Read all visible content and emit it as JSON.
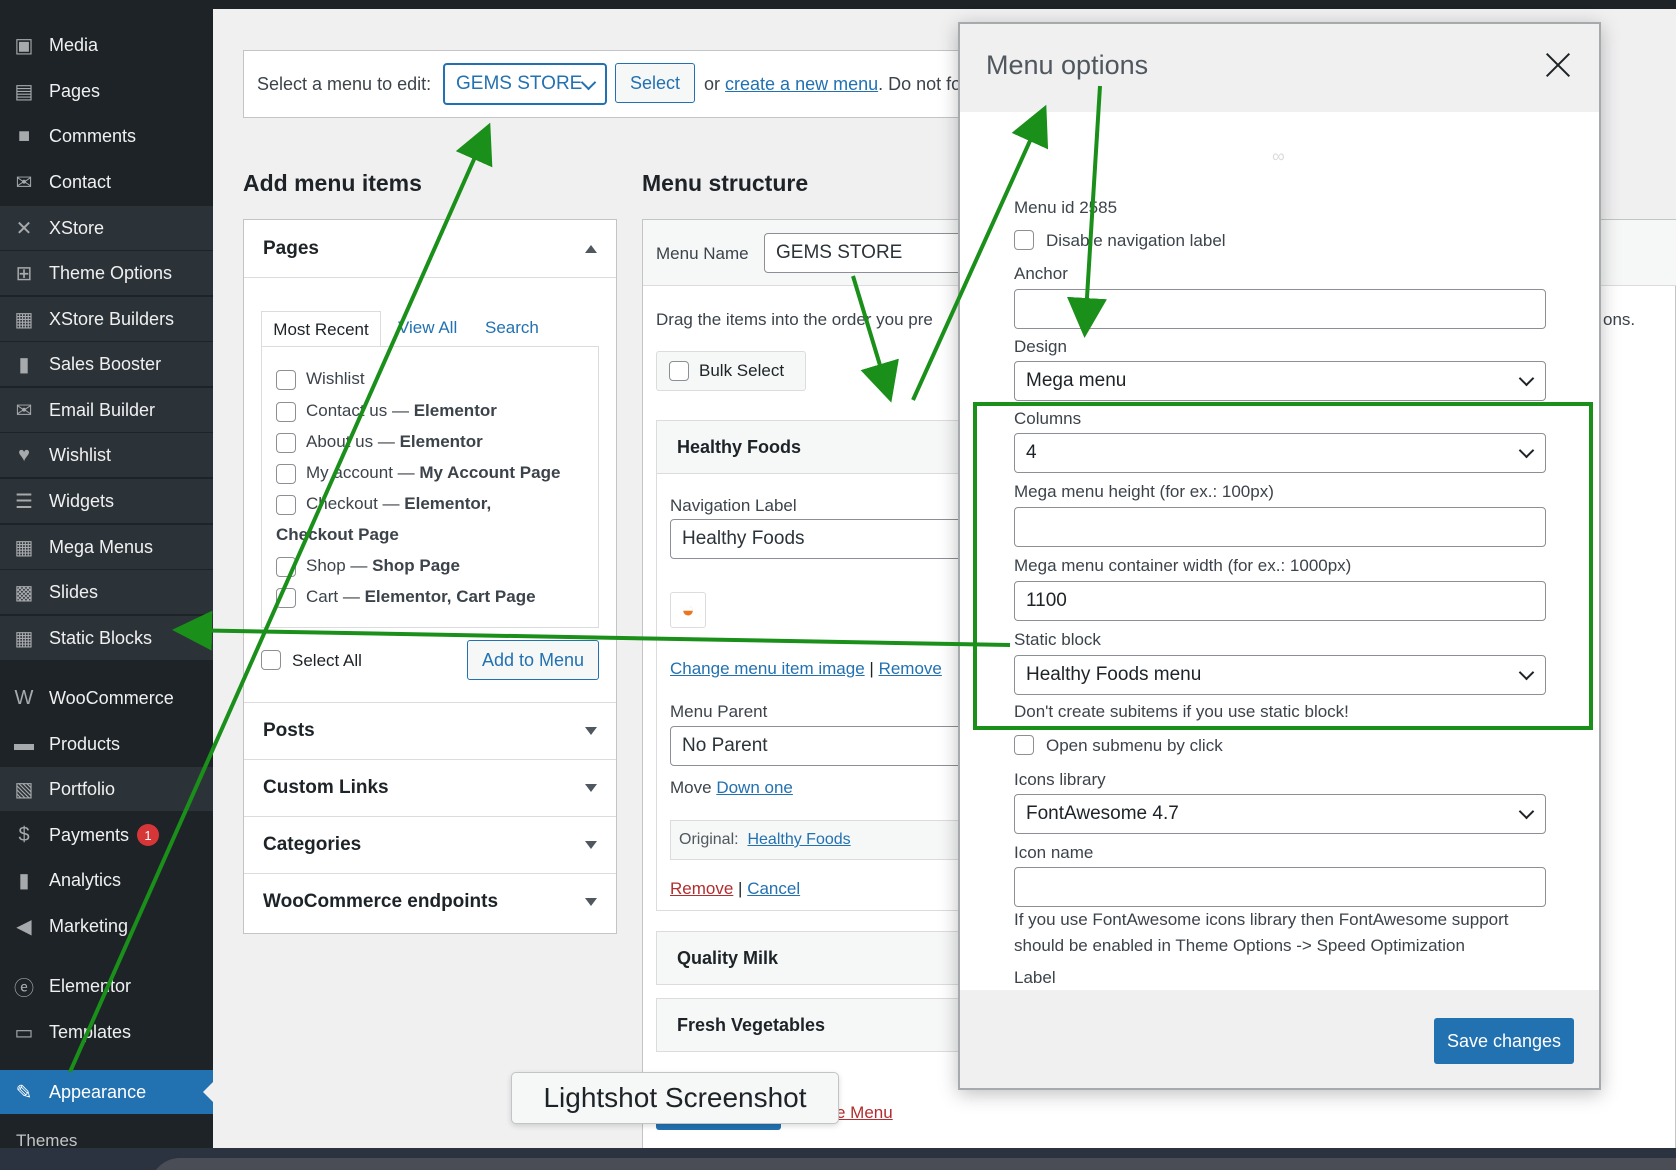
{
  "sidebar": {
    "items": [
      {
        "label": "Media",
        "icon": "media-icon",
        "glyph": "▣"
      },
      {
        "label": "Pages",
        "icon": "pages-icon",
        "glyph": "▤"
      },
      {
        "label": "Comments",
        "icon": "comments-icon",
        "glyph": "■"
      },
      {
        "label": "Contact",
        "icon": "mail-icon",
        "glyph": "✉"
      },
      {
        "label": "XStore",
        "icon": "xstore-icon",
        "glyph": "✕"
      },
      {
        "label": "Theme Options",
        "icon": "theme-options-icon",
        "glyph": "⊞"
      },
      {
        "label": "XStore Builders",
        "icon": "builders-icon",
        "glyph": "▦"
      },
      {
        "label": "Sales Booster",
        "icon": "chart-icon",
        "glyph": "▮"
      },
      {
        "label": "Email Builder",
        "icon": "email-icon",
        "glyph": "✉"
      },
      {
        "label": "Wishlist",
        "icon": "heart-icon",
        "glyph": "♥"
      },
      {
        "label": "Widgets",
        "icon": "widgets-icon",
        "glyph": "☰"
      },
      {
        "label": "Mega Menus",
        "icon": "mega-menus-icon",
        "glyph": "▦"
      },
      {
        "label": "Slides",
        "icon": "slides-icon",
        "glyph": "▩"
      },
      {
        "label": "Static Blocks",
        "icon": "static-blocks-icon",
        "glyph": "▦"
      },
      {
        "label": "WooCommerce",
        "icon": "woocommerce-icon",
        "glyph": "W"
      },
      {
        "label": "Products",
        "icon": "products-icon",
        "glyph": "▬"
      },
      {
        "label": "Portfolio",
        "icon": "portfolio-icon",
        "glyph": "▧"
      },
      {
        "label": "Payments",
        "icon": "payments-icon",
        "glyph": "$"
      },
      {
        "label": "Analytics",
        "icon": "analytics-icon",
        "glyph": "▮"
      },
      {
        "label": "Marketing",
        "icon": "megaphone-icon",
        "glyph": "◀"
      },
      {
        "label": "Elementor",
        "icon": "elementor-icon",
        "glyph": "ⓔ"
      },
      {
        "label": "Templates",
        "icon": "folder-icon",
        "glyph": "▭"
      },
      {
        "label": "Appearance",
        "icon": "paintbrush-icon",
        "glyph": "✎"
      }
    ],
    "payments_badge": "1",
    "submenu_themes": "Themes"
  },
  "select_bar": {
    "label": "Select a menu to edit:",
    "selected_menu": "GEMS STORE",
    "select_button": "Select",
    "or_text": "or",
    "create_link": "create a new menu",
    "rest_text": ". Do not fo"
  },
  "add_items": {
    "title": "Add menu items",
    "pages_title": "Pages",
    "tabs": [
      "Most Recent",
      "View All",
      "Search"
    ],
    "pages": [
      {
        "name": "Wishlist",
        "suffix": ""
      },
      {
        "name": "Contact us — ",
        "suffix": "Elementor"
      },
      {
        "name": "About us — ",
        "suffix": "Elementor"
      },
      {
        "name": "My account — ",
        "suffix": "My Account Page"
      },
      {
        "name": "Checkout — ",
        "suffix": "Elementor,"
      },
      {
        "name": "",
        "suffix": "Checkout Page"
      },
      {
        "name": "Shop — ",
        "suffix": "Shop Page"
      },
      {
        "name": "Cart — ",
        "suffix": "Elementor, Cart Page"
      }
    ],
    "select_all": "Select All",
    "add_to_menu": "Add to Menu",
    "sections": [
      "Posts",
      "Custom Links",
      "Categories",
      "WooCommerce endpoints"
    ]
  },
  "structure": {
    "title": "Menu structure",
    "menu_name_label": "Menu Name",
    "menu_name_value": "GEMS STORE",
    "drag_text": "Drag the items into the order you pre",
    "right_text": "ons.",
    "bulk_select": "Bulk Select",
    "item1_title": "Healthy Foods",
    "nav_label_label": "Navigation Label",
    "nav_label_value": "Healthy Foods",
    "change_image": "Change menu item image",
    "separator": "|",
    "remove_image": "Remove",
    "menu_parent_label": "Menu Parent",
    "menu_parent_value": "No Parent",
    "move_label": "Move",
    "move_link": "Down one",
    "original_label": "Original:",
    "original_link": "Healthy Foods",
    "remove": "Remove",
    "cancel": "Cancel",
    "item2_title": "Quality Milk",
    "item3_title": "Fresh Vegetables",
    "delete_menu_fragment": "e Menu"
  },
  "modal": {
    "title": "Menu options",
    "spinner": "∞",
    "menu_id": "Menu id 2585",
    "disable_nav_label": "Disable navigation label",
    "anchor_label": "Anchor",
    "anchor_value": "",
    "design_label": "Design",
    "design_value": "Mega menu",
    "columns_label": "Columns",
    "columns_value": "4",
    "height_label": "Mega menu height (for ex.: 100px)",
    "height_value": "",
    "width_label": "Mega menu container width (for ex.: 1000px)",
    "width_value": "1100",
    "static_block_label": "Static block",
    "static_block_value": "Healthy Foods menu",
    "static_note": "Don't create subitems if you use static block!",
    "open_submenu": "Open submenu by click",
    "icons_library_label": "Icons library",
    "icons_library_value": "FontAwesome 4.7",
    "icon_name_label": "Icon name",
    "icon_name_value": "",
    "fa_note_1": "If you use FontAwesome icons library then FontAwesome support",
    "fa_note_2": "should be enabled in Theme Options -> Speed Optimization",
    "label_label": "Label",
    "save_button": "Save changes"
  },
  "lightshot_label": "Lightshot Screenshot",
  "colors": {
    "accent": "#2271b1",
    "sidebar": "#1d2327",
    "annotation_green": "#1a8f1a",
    "badge_red": "#d63638"
  }
}
